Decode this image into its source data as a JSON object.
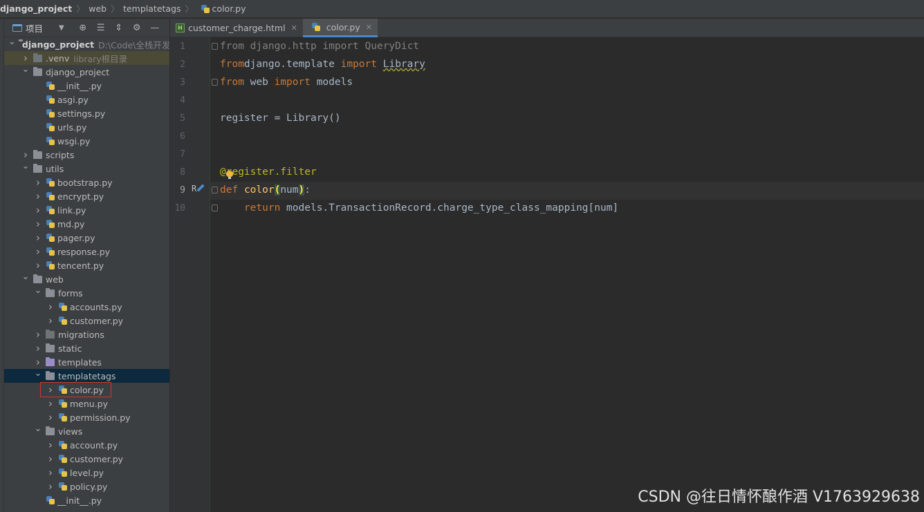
{
  "breadcrumb": [
    "django_project",
    "web",
    "templatetags",
    "color.py"
  ],
  "project_panel": {
    "title": "项目",
    "buttons": [
      "target-icon",
      "expand-all-icon",
      "collapse-all-icon",
      "gear-icon",
      "minimize-icon"
    ]
  },
  "tree": [
    {
      "label": "django_project",
      "hint": "D:\\Code\\全栈开发",
      "type": "folder",
      "level": 0,
      "expanded": true,
      "bold": true
    },
    {
      "label": ".venv",
      "hint": "library根目录",
      "type": "folder-dark",
      "level": 1,
      "expanded": false
    },
    {
      "label": "django_project",
      "type": "folder",
      "level": 1,
      "expanded": true
    },
    {
      "label": "__init__.py",
      "type": "py",
      "level": 2,
      "leaf": true
    },
    {
      "label": "asgi.py",
      "type": "py",
      "level": 2,
      "leaf": true
    },
    {
      "label": "settings.py",
      "type": "py",
      "level": 2,
      "leaf": true
    },
    {
      "label": "urls.py",
      "type": "py",
      "level": 2,
      "leaf": true
    },
    {
      "label": "wsgi.py",
      "type": "py",
      "level": 2,
      "leaf": true
    },
    {
      "label": "scripts",
      "type": "folder",
      "level": 1,
      "expanded": false
    },
    {
      "label": "utils",
      "type": "folder",
      "level": 1,
      "expanded": true
    },
    {
      "label": "bootstrap.py",
      "type": "py",
      "level": 2,
      "expanded": false
    },
    {
      "label": "encrypt.py",
      "type": "py",
      "level": 2,
      "expanded": false
    },
    {
      "label": "link.py",
      "type": "py",
      "level": 2,
      "expanded": false
    },
    {
      "label": "md.py",
      "type": "py",
      "level": 2,
      "expanded": false
    },
    {
      "label": "pager.py",
      "type": "py",
      "level": 2,
      "expanded": false
    },
    {
      "label": "response.py",
      "type": "py",
      "level": 2,
      "expanded": false
    },
    {
      "label": "tencent.py",
      "type": "py",
      "level": 2,
      "expanded": false
    },
    {
      "label": "web",
      "type": "folder",
      "level": 1,
      "expanded": true
    },
    {
      "label": "forms",
      "type": "folder",
      "level": 2,
      "expanded": true
    },
    {
      "label": "accounts.py",
      "type": "py",
      "level": 3,
      "expanded": false
    },
    {
      "label": "customer.py",
      "type": "py",
      "level": 3,
      "expanded": false
    },
    {
      "label": "migrations",
      "type": "folder-dark",
      "level": 2,
      "expanded": false
    },
    {
      "label": "static",
      "type": "folder",
      "level": 2,
      "expanded": false
    },
    {
      "label": "templates",
      "type": "folder-purple",
      "level": 2,
      "expanded": false
    },
    {
      "label": "templatetags",
      "type": "folder",
      "level": 2,
      "expanded": true,
      "selected": true
    },
    {
      "label": "color.py",
      "type": "py",
      "level": 3,
      "expanded": false,
      "boxed": true
    },
    {
      "label": "menu.py",
      "type": "py",
      "level": 3,
      "expanded": false
    },
    {
      "label": "permission.py",
      "type": "py",
      "level": 3,
      "expanded": false
    },
    {
      "label": "views",
      "type": "folder",
      "level": 2,
      "expanded": true
    },
    {
      "label": "account.py",
      "type": "py",
      "level": 3,
      "expanded": false
    },
    {
      "label": "customer.py",
      "type": "py",
      "level": 3,
      "expanded": false
    },
    {
      "label": "level.py",
      "type": "py",
      "level": 3,
      "expanded": false
    },
    {
      "label": "policy.py",
      "type": "py",
      "level": 3,
      "expanded": false
    },
    {
      "label": "__init__.py",
      "type": "py",
      "level": 2,
      "leaf": true
    }
  ],
  "tabs": [
    {
      "label": "customer_charge.html",
      "icon": "html-file-icon",
      "active": false
    },
    {
      "label": "color.py",
      "icon": "python-file-icon",
      "active": true
    }
  ],
  "editor": {
    "line_numbers": [
      "1",
      "2",
      "3",
      "4",
      "5",
      "6",
      "7",
      "8",
      "9",
      "10"
    ],
    "current_line": 9,
    "lines": [
      [
        [
          "dim",
          "from django.http import QueryDict"
        ]
      ],
      [
        [
          "kw",
          "from"
        ],
        [
          "",
          "django.template "
        ],
        [
          "kw",
          "import"
        ],
        [
          "",
          " "
        ],
        [
          "ul",
          "Library"
        ]
      ],
      [
        [
          "kw",
          "from"
        ],
        [
          "",
          " web "
        ],
        [
          "kw",
          "import"
        ],
        [
          "",
          " models"
        ]
      ],
      [],
      [
        [
          "",
          "register = Library()"
        ]
      ],
      [],
      [],
      [
        [
          "deco",
          "@"
        ],
        [
          "deco",
          "register.filter"
        ]
      ],
      [
        [
          "kw",
          "def"
        ],
        [
          "",
          " "
        ],
        [
          "fn",
          "color"
        ],
        [
          "paren",
          "("
        ],
        [
          "",
          "num"
        ],
        [
          "paren",
          ")"
        ],
        [
          "",
          ":"
        ]
      ],
      [
        [
          "",
          "    "
        ],
        [
          "kw",
          "return"
        ],
        [
          "",
          " models.TransactionRecord.charge_type_class_mapping[num]"
        ]
      ]
    ]
  },
  "watermark": "CSDN @往日情怀酿作酒 V1763929638"
}
